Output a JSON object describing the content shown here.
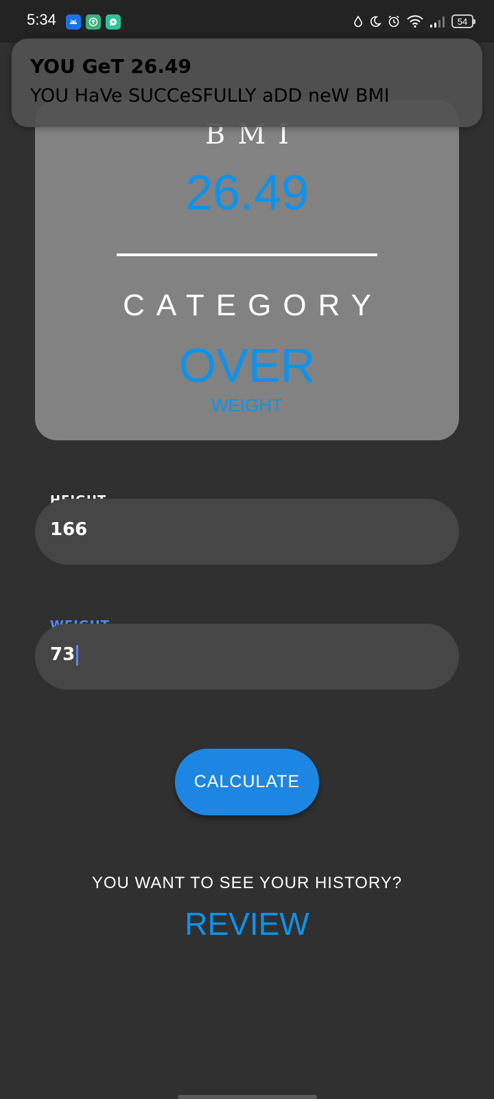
{
  "status_bar": {
    "time": "5:34",
    "battery_level": "54",
    "notification_icons": [
      "android-icon",
      "upload-app-icon",
      "chat-app-icon"
    ],
    "system_icons": [
      "water-drop-icon",
      "moon-icon",
      "alarm-icon",
      "wifi-icon",
      "signal-icon",
      "battery-icon"
    ]
  },
  "toast": {
    "title": "YOU GeT 26.49",
    "message": "YOU HaVe SUCCeSFULLY aDD neW BMI"
  },
  "result_card": {
    "bmi_label": "BMI",
    "bmi_value": "26.49",
    "category_label": "CATEGORY",
    "category_value": "OVER",
    "category_sub": "WEIGHT"
  },
  "height_field": {
    "label": "HEIGHT",
    "value": "166"
  },
  "weight_field": {
    "label": "WEIGHT",
    "value": "73"
  },
  "calculate_button": {
    "label": "CALCULATE"
  },
  "history": {
    "question": "YOU WANT TO SEE YOUR HISTORY?",
    "link": "REVIEW"
  },
  "colors": {
    "background": "#303030",
    "accent": "#0d93ee",
    "button": "#1d86e3",
    "card": "#828282",
    "field": "#464646",
    "focus_label": "#4d8cf5"
  }
}
